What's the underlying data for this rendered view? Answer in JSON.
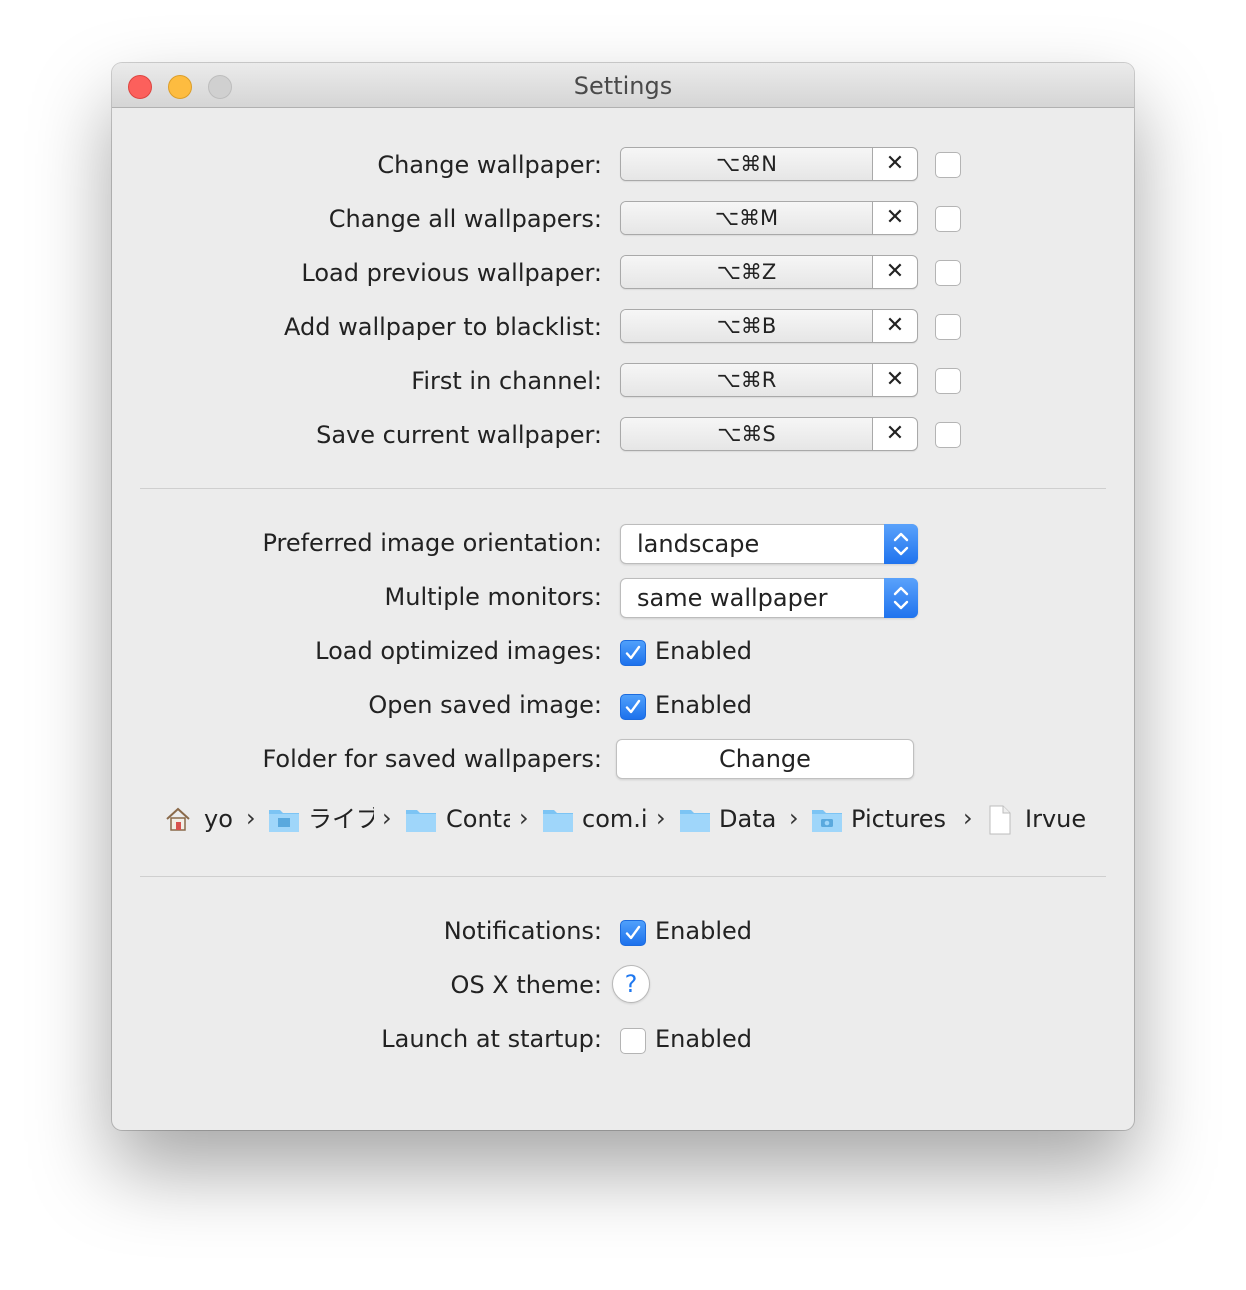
{
  "window": {
    "title": "Settings"
  },
  "shortcuts": [
    {
      "label": "Change wallpaper:",
      "keys": "⌥⌘N",
      "clear": "✕"
    },
    {
      "label": "Change all wallpapers:",
      "keys": "⌥⌘M",
      "clear": "✕"
    },
    {
      "label": "Load previous wallpaper:",
      "keys": "⌥⌘Z",
      "clear": "✕"
    },
    {
      "label": "Add wallpaper to blacklist:",
      "keys": "⌥⌘B",
      "clear": "✕"
    },
    {
      "label": "First in channel:",
      "keys": "⌥⌘R",
      "clear": "✕"
    },
    {
      "label": "Save current wallpaper:",
      "keys": "⌥⌘S",
      "clear": "✕"
    }
  ],
  "options": {
    "orientation": {
      "label": "Preferred image orientation:",
      "value": "landscape"
    },
    "monitors": {
      "label": "Multiple monitors:",
      "value": "same wallpaper"
    },
    "optimized": {
      "label": "Load optimized images:",
      "checked": true,
      "text": "Enabled"
    },
    "open_saved": {
      "label": "Open saved image:",
      "checked": true,
      "text": "Enabled"
    },
    "folder": {
      "label": "Folder for saved wallpapers:",
      "button": "Change"
    }
  },
  "path": [
    {
      "name": "yo",
      "icon": "home-icon"
    },
    {
      "name": "ライブラリ",
      "icon": "library-folder-icon"
    },
    {
      "name": "Containers",
      "icon": "folder-icon"
    },
    {
      "name": "com.irvue",
      "icon": "folder-icon"
    },
    {
      "name": "Data",
      "icon": "folder-icon"
    },
    {
      "name": "Pictures",
      "icon": "pictures-folder-icon"
    },
    {
      "name": "Irvue",
      "icon": "document-icon"
    }
  ],
  "path_separator": "›",
  "general": {
    "notifications": {
      "label": "Notifications:",
      "checked": true,
      "text": "Enabled"
    },
    "theme": {
      "label": "OS X theme:",
      "button": "?"
    },
    "startup": {
      "label": "Launch at startup:",
      "checked": false,
      "text": "Enabled"
    }
  },
  "colors": {
    "accent": "#1f73ee",
    "window_bg": "#ececec"
  }
}
